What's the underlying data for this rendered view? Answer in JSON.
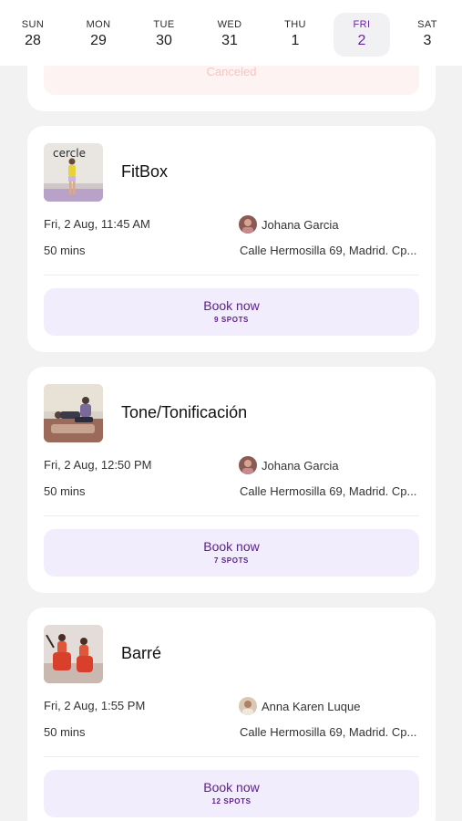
{
  "week": [
    {
      "dow": "SUN",
      "num": "28"
    },
    {
      "dow": "MON",
      "num": "29"
    },
    {
      "dow": "TUE",
      "num": "30"
    },
    {
      "dow": "WED",
      "num": "31"
    },
    {
      "dow": "THU",
      "num": "1"
    },
    {
      "dow": "FRI",
      "num": "2"
    },
    {
      "dow": "SAT",
      "num": "3"
    }
  ],
  "selected_day": "FRI",
  "previous_card": {
    "status": "Canceled"
  },
  "classes": [
    {
      "title": "FitBox",
      "datetime": "Fri, 2 Aug, 11:45 AM",
      "duration": "50 mins",
      "instructor": "Johana Garcia",
      "location": "Calle Hermosilla 69, Madrid. Cp...",
      "button": "Book now",
      "spots": "9 SPOTS",
      "thumb_text": "cercle"
    },
    {
      "title": "Tone/Tonificación",
      "datetime": "Fri, 2 Aug, 12:50 PM",
      "duration": "50 mins",
      "instructor": "Johana Garcia",
      "location": "Calle Hermosilla 69, Madrid. Cp...",
      "button": "Book now",
      "spots": "7 SPOTS"
    },
    {
      "title": "Barré",
      "datetime": "Fri, 2 Aug, 1:55 PM",
      "duration": "50 mins",
      "instructor": "Anna Karen Luque",
      "location": "Calle Hermosilla 69, Madrid. Cp...",
      "button": "Book now",
      "spots": "12 SPOTS"
    }
  ],
  "colors": {
    "accent": "#5b1f8c",
    "button_bg": "#f1edfc",
    "page_bg": "#f2f2f3"
  }
}
